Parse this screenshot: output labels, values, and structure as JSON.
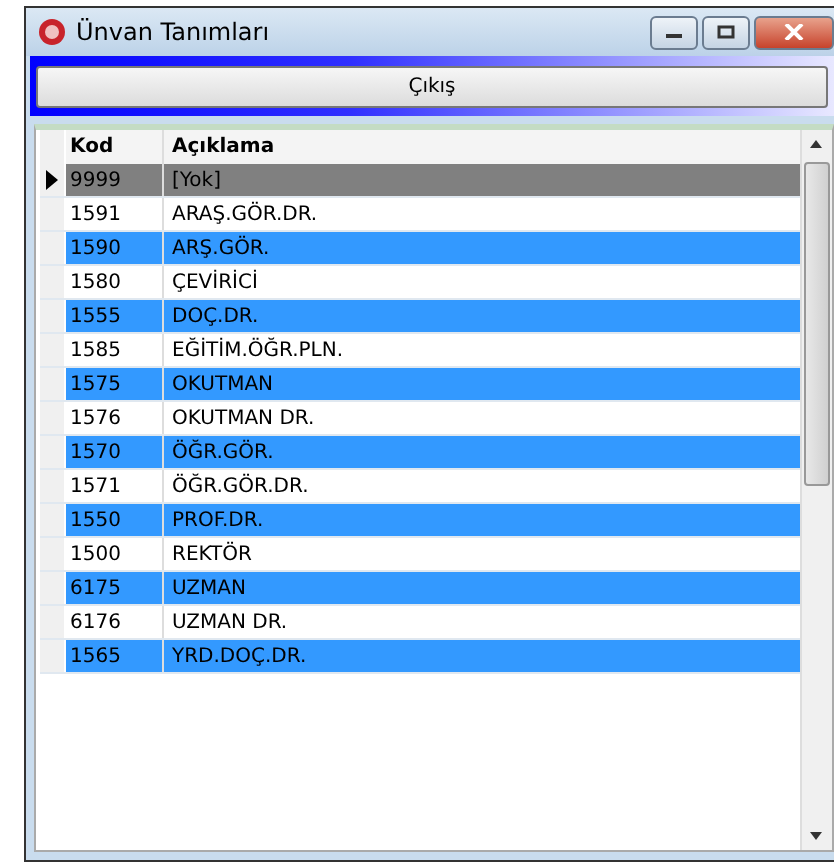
{
  "window": {
    "title": "Ünvan Tanımları"
  },
  "exit_button": {
    "label": "Çıkış"
  },
  "table": {
    "columns": [
      "Kod",
      "Açıklama"
    ],
    "rows": [
      {
        "code": "9999",
        "description": "[Yok]",
        "selected": true
      },
      {
        "code": "1591",
        "description": "ARAŞ.GÖR.DR.",
        "selected": false
      },
      {
        "code": "1590",
        "description": "ARŞ.GÖR.",
        "selected": false
      },
      {
        "code": "1580",
        "description": "ÇEVİRİCİ",
        "selected": false
      },
      {
        "code": "1555",
        "description": "DOÇ.DR.",
        "selected": false
      },
      {
        "code": "1585",
        "description": "EĞİTİM.ÖĞR.PLN.",
        "selected": false
      },
      {
        "code": "1575",
        "description": "OKUTMAN",
        "selected": false
      },
      {
        "code": "1576",
        "description": "OKUTMAN DR.",
        "selected": false
      },
      {
        "code": "1570",
        "description": "ÖĞR.GÖR.",
        "selected": false
      },
      {
        "code": "1571",
        "description": "ÖĞR.GÖR.DR.",
        "selected": false
      },
      {
        "code": "1550",
        "description": "PROF.DR.",
        "selected": false
      },
      {
        "code": "1500",
        "description": "REKTÖR",
        "selected": false
      },
      {
        "code": "6175",
        "description": "UZMAN",
        "selected": false
      },
      {
        "code": "6176",
        "description": "UZMAN DR.",
        "selected": false
      },
      {
        "code": "1565",
        "description": "YRD.DOÇ.DR.",
        "selected": false
      }
    ]
  }
}
